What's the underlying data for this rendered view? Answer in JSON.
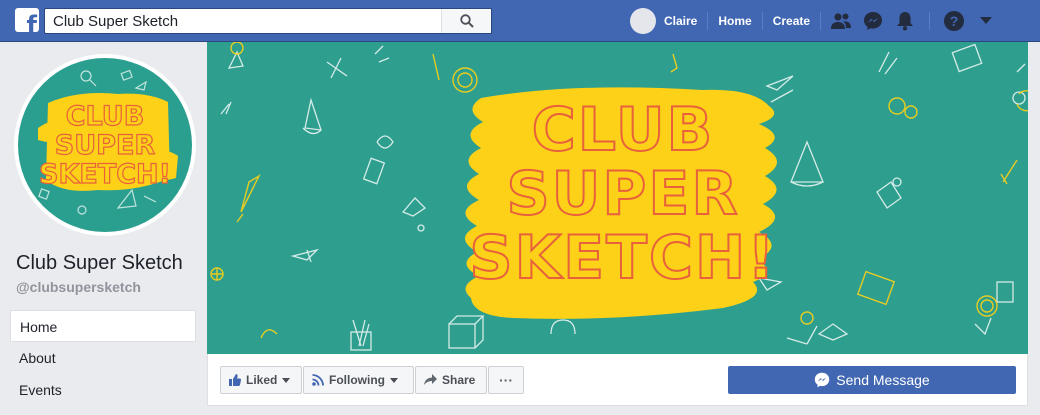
{
  "header": {
    "logo_icon": "facebook-f-icon",
    "search_value": "Club Super Sketch",
    "user_name": "Claire",
    "nav_home": "Home",
    "nav_create": "Create",
    "icons": [
      "friends-icon",
      "messenger-icon",
      "bell-icon",
      "help-icon",
      "caret-down-icon"
    ],
    "bar_color": "#4267b2"
  },
  "page": {
    "name": "Club Super Sketch",
    "handle": "@clubsupersketch",
    "logo_lines": [
      "CLUB",
      "SUPER",
      "SKETCH!"
    ],
    "accent_yellow": "#fcd117",
    "accent_teal": "#2e9e8e"
  },
  "sidebar": {
    "items": [
      {
        "label": "Home",
        "active": true
      },
      {
        "label": "About",
        "active": false
      },
      {
        "label": "Events",
        "active": false
      }
    ]
  },
  "cover": {
    "title_lines": [
      "CLUB",
      "SUPER",
      "SKETCH!"
    ]
  },
  "actions": {
    "liked": "Liked",
    "following": "Following",
    "share": "Share",
    "more": "···",
    "send_message": "Send Message"
  }
}
